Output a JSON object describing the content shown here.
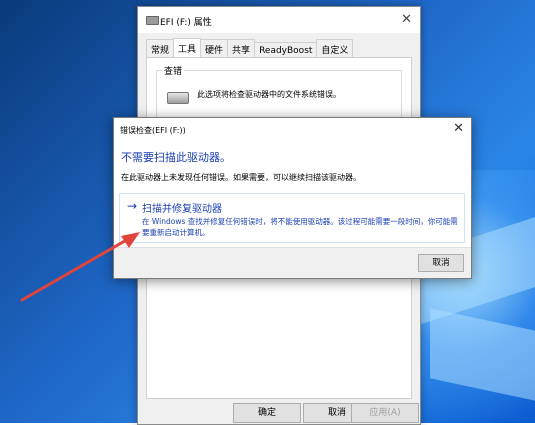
{
  "properties_window": {
    "title": "EFI (F:) 属性",
    "tabs": [
      "常规",
      "工具",
      "硬件",
      "共享",
      "ReadyBoost",
      "自定义"
    ],
    "active_tab": "工具",
    "group_label": "查错",
    "group_desc": "此选项将检查驱动器中的文件系统错误。",
    "ok": "确定",
    "cancel": "取消",
    "apply": "应用(A)"
  },
  "dialog": {
    "title": "错误检查(EFI (F:))",
    "heading": "不需要扫描此驱动器。",
    "info": "在此驱动器上未发现任何错误。如果需要，可以继续扫描该驱动器。",
    "command_title": "扫描并修复驱动器",
    "command_desc": "在 Windows 查找并修复任何错误时，将不能使用驱动器。该过程可能需要一段时间，你可能需要重新启动计算机。",
    "arrow_glyph": "→",
    "cancel": "取消"
  },
  "colors": {
    "accent": "#1a3fb0",
    "annotation": "#e0443a"
  }
}
